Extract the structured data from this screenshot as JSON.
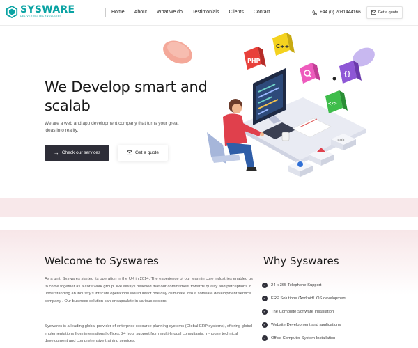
{
  "brand": {
    "name": "SYSWARE",
    "tagline": "DELIVERING TECHNOLOGIES",
    "color": "#0aa3a3"
  },
  "nav": {
    "items": [
      "Home",
      "About",
      "What we do",
      "Testimonials",
      "Clients",
      "Contact"
    ]
  },
  "contact": {
    "phone": "+44 (0) 2081444166",
    "quote_label": "Get a quote"
  },
  "hero": {
    "title": "We Develop smart and scalab",
    "subtitle": "We are a web and app development company that turns your great ideas into reality.",
    "primary_button": "Check our services",
    "secondary_button": "Get a quote",
    "illustration_labels": {
      "php": "PHP",
      "cpp": "C++",
      "braces": "{}",
      "code": "</>"
    }
  },
  "welcome": {
    "title": "Welcome to Syswares",
    "paragraph1": "As a unit, Syswares started its operation in the UK in 2014. The experience of our team in core industries enabled us to come together as a core work group. We always believed that our commitment towards quality and perceptions in understanding an industry's intricate operations would infact one day culminate into a software development service company . Our business solution can encapsulate in various sectors.",
    "paragraph2": "Syswares is a leading global provider of enterprise resource planning systems (Global ERP systems), offering global implementations from international offices, 24 hour support from multi-lingual consultants, in-house technical development and comprehensive training services."
  },
  "why": {
    "title": "Why Syswares",
    "items": [
      "24 x 365 Telephone Support",
      "ERP Solutions /Android/ iOS development",
      "The Complete Software Installation",
      "Website Development and applications",
      "Office Computer System Installation"
    ]
  },
  "colors": {
    "dark_button": "#2e2e38",
    "band": "#f8e8ea",
    "accent_teal": "#0aa3a3"
  }
}
